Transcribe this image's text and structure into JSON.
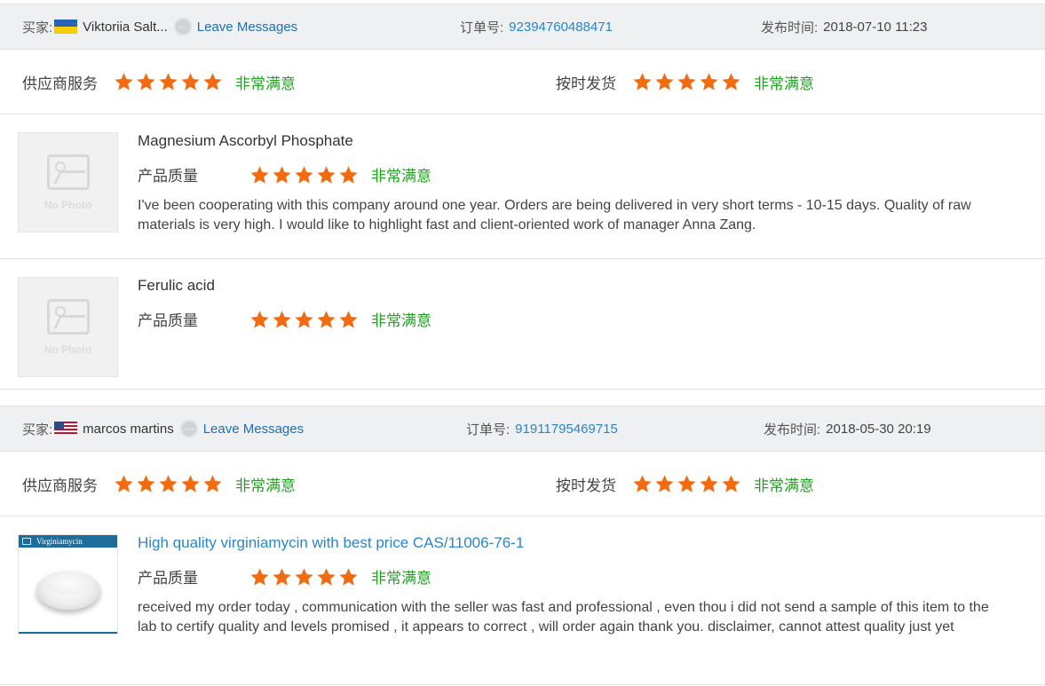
{
  "labels": {
    "buyer": "买家:",
    "leave_messages": "Leave Messages",
    "order_no": "订单号:",
    "published": "发布时间:",
    "supplier_service": "供应商服务",
    "on_time_delivery": "按时发货",
    "product_quality": "产品质量",
    "very_satisfied": "非常满意",
    "no_photo": "No Photo"
  },
  "colors": {
    "star": "#f26b10",
    "satisfied": "#1fa31f",
    "link": "#2a85c9",
    "header_bg": "#eef0f2"
  },
  "reviews": [
    {
      "buyer_name": "Viktoriia Salt...",
      "flag": "ukraine-flag",
      "order_number": "92394760488471",
      "date": "2018-07-10 11:23",
      "supplier_stars": 5,
      "delivery_stars": 5,
      "products": [
        {
          "name": "Magnesium Ascorbyl Phosphate",
          "quality_stars": 5,
          "comment": "I've been cooperating with this company around one year. Orders are being delivered in very short terms - 10-15 days. Quality of raw materials is very high. I would like to highlight fast and client-oriented work of manager Anna Zang."
        },
        {
          "name": "Ferulic acid",
          "quality_stars": 5,
          "comment": ""
        }
      ]
    },
    {
      "buyer_name": "marcos martins",
      "flag": "usa-flag",
      "order_number": "91911795469715",
      "date": "2018-05-30 20:19",
      "supplier_stars": 5,
      "delivery_stars": 5,
      "products": [
        {
          "name": "High quality virginiamycin with best price CAS/11006-76-1",
          "image_label": "Virginiamycin",
          "quality_stars": 5,
          "comment": "received my order today , communication with the seller was fast and professional , even thou i did not send a sample of this item to the lab to certify quality and levels promised , it appears to correct , will order again thank you. disclaimer, cannot attest quality just yet"
        }
      ]
    }
  ]
}
